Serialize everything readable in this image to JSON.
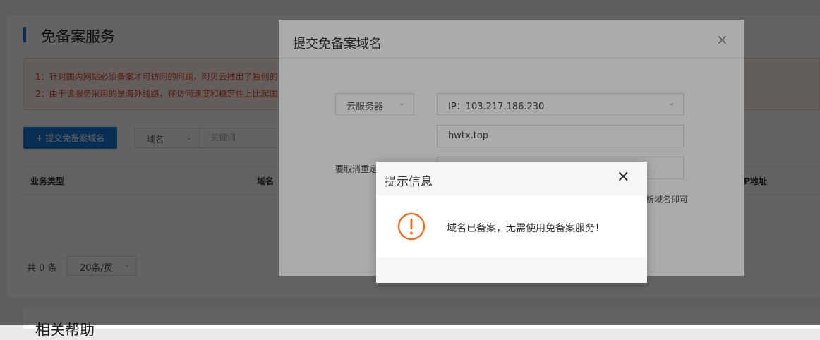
{
  "background": {
    "page_title": "免备案服务",
    "notice_lines": [
      "1：针对国内网站必须备案才可访问的问题，阿贝云推出了独创的",
      "2：由于该服务采用的是海外线路，在访问速度和稳定性上比起国"
    ],
    "submit_button": "+ 提交免备案域名",
    "filter_select": "域名",
    "keyword_placeholder": "关键词",
    "table_headers": [
      "业务类型",
      "域名",
      "P地址"
    ],
    "total_text": "共 0 条",
    "page_size": "20条/页",
    "section2_title": "相关帮助"
  },
  "dialog": {
    "title": "提交免备案域名",
    "close_icon": "×",
    "server_type": "云服务器",
    "ip_value": "IP：103.217.186.230",
    "domain_value": "hwtx.top",
    "cancel_redirect_label": "要取消重定",
    "hint_tail": "析域名即可"
  },
  "alert": {
    "title": "提示信息",
    "close_icon": "✕",
    "message": "域名已备案，无需使用免备案服务！",
    "icon": "warning-circle-icon",
    "accent_color": "#e8702a"
  }
}
